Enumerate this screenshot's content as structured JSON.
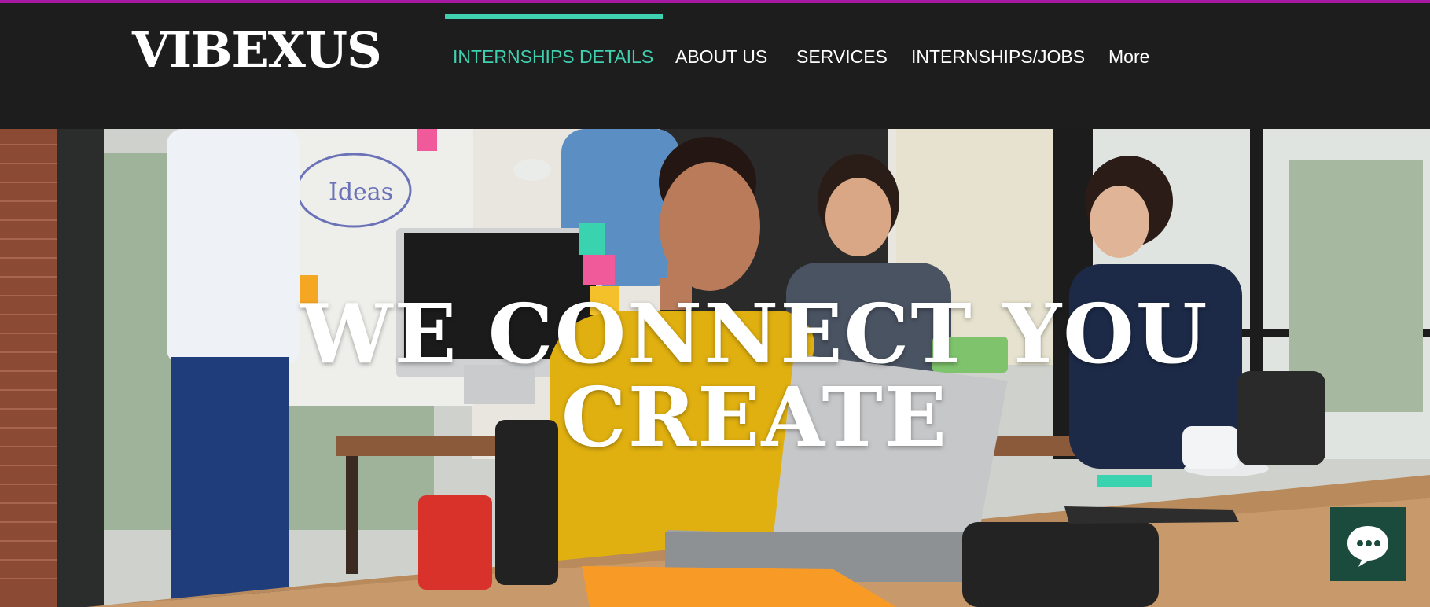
{
  "header": {
    "logo": "VIBEXUS",
    "nav": [
      {
        "label": "INTERNSHIPS DETAILS",
        "active": true
      },
      {
        "label": "ABOUT US",
        "active": false
      },
      {
        "label": "SERVICES",
        "active": false
      },
      {
        "label": "INTERNSHIPS/JOBS",
        "active": false
      },
      {
        "label": "More",
        "active": false
      }
    ]
  },
  "hero": {
    "title_line1": "WE CONNECT YOU",
    "title_line2": "CREATE",
    "whiteboard_text": "Ideas",
    "image_description_icon": "office-team-photo"
  },
  "chat": {
    "icon": "chat-bubble-icon"
  },
  "colors": {
    "header_bg": "#1d1d1d",
    "accent": "#3fd0b0",
    "top_line": "#a51aa0",
    "chat_bg": "#1b4b3d"
  }
}
